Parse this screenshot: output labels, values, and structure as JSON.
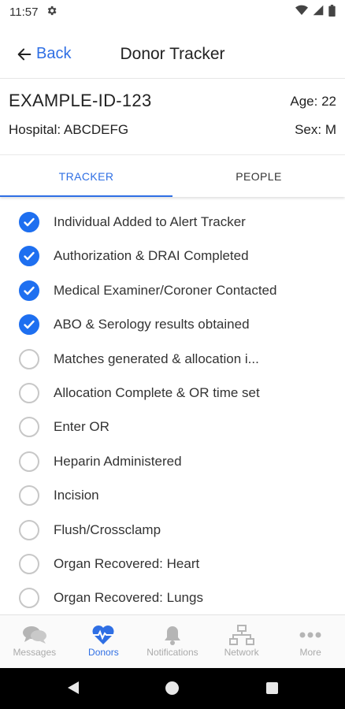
{
  "status_bar": {
    "time": "11:57"
  },
  "header": {
    "back_label": "Back",
    "title": "Donor Tracker"
  },
  "donor": {
    "id": "EXAMPLE-ID-123",
    "age": "Age: 22",
    "hospital": "Hospital: ABCDEFG",
    "sex": "Sex: M"
  },
  "tabs": [
    {
      "label": "TRACKER",
      "active": true
    },
    {
      "label": "PEOPLE",
      "active": false
    }
  ],
  "checklist": [
    {
      "label": "Individual Added to Alert Tracker",
      "checked": true
    },
    {
      "label": "Authorization & DRAI Completed",
      "checked": true
    },
    {
      "label": "Medical Examiner/Coroner Contacted",
      "checked": true
    },
    {
      "label": "ABO & Serology results obtained",
      "checked": true
    },
    {
      "label": "Matches generated & allocation i...",
      "checked": false
    },
    {
      "label": "Allocation Complete & OR time set",
      "checked": false
    },
    {
      "label": "Enter OR",
      "checked": false
    },
    {
      "label": "Heparin Administered",
      "checked": false
    },
    {
      "label": "Incision",
      "checked": false
    },
    {
      "label": "Flush/Crossclamp",
      "checked": false
    },
    {
      "label": "Organ Recovered: Heart",
      "checked": false
    },
    {
      "label": "Organ Recovered: Lungs",
      "checked": false
    }
  ],
  "bottom_nav": [
    {
      "label": "Messages",
      "icon": "messages-icon",
      "active": false
    },
    {
      "label": "Donors",
      "icon": "heart-pulse-icon",
      "active": true
    },
    {
      "label": "Notifications",
      "icon": "bell-icon",
      "active": false
    },
    {
      "label": "Network",
      "icon": "network-icon",
      "active": false
    },
    {
      "label": "More",
      "icon": "more-icon",
      "active": false
    }
  ],
  "colors": {
    "accent": "#2f6fe4",
    "check_fill": "#1e6ff0",
    "inactive": "#aaaaaa"
  }
}
